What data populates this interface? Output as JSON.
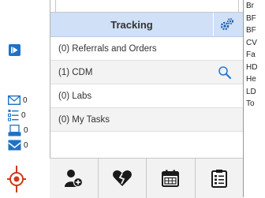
{
  "left_rail": {
    "items": [
      {
        "icon": "envelope-icon",
        "count": "0"
      },
      {
        "icon": "list-icon",
        "count": "0"
      },
      {
        "icon": "document-tray-icon",
        "count": "0"
      },
      {
        "icon": "inbox-icon",
        "count": "0"
      }
    ]
  },
  "tracking": {
    "title": "Tracking",
    "items": [
      {
        "label": "(0) Referrals and Orders"
      },
      {
        "label": "(1) CDM"
      },
      {
        "label": "(0) Labs"
      },
      {
        "label": "(0) My Tasks"
      }
    ]
  },
  "bottom_toolbar": {
    "buttons": [
      {
        "icon": "add-user-icon"
      },
      {
        "icon": "broken-heart-icon"
      },
      {
        "icon": "calendar-icon"
      },
      {
        "icon": "checklist-icon"
      }
    ]
  },
  "right_list": {
    "items": [
      "Br",
      "BF",
      "BF",
      "CV",
      "Fa",
      "HD",
      "He",
      "LD",
      "To"
    ]
  },
  "colors": {
    "header_bg": "#cfe0f7",
    "accent_blue": "#1f72c4",
    "alert_red": "#d0381e"
  }
}
